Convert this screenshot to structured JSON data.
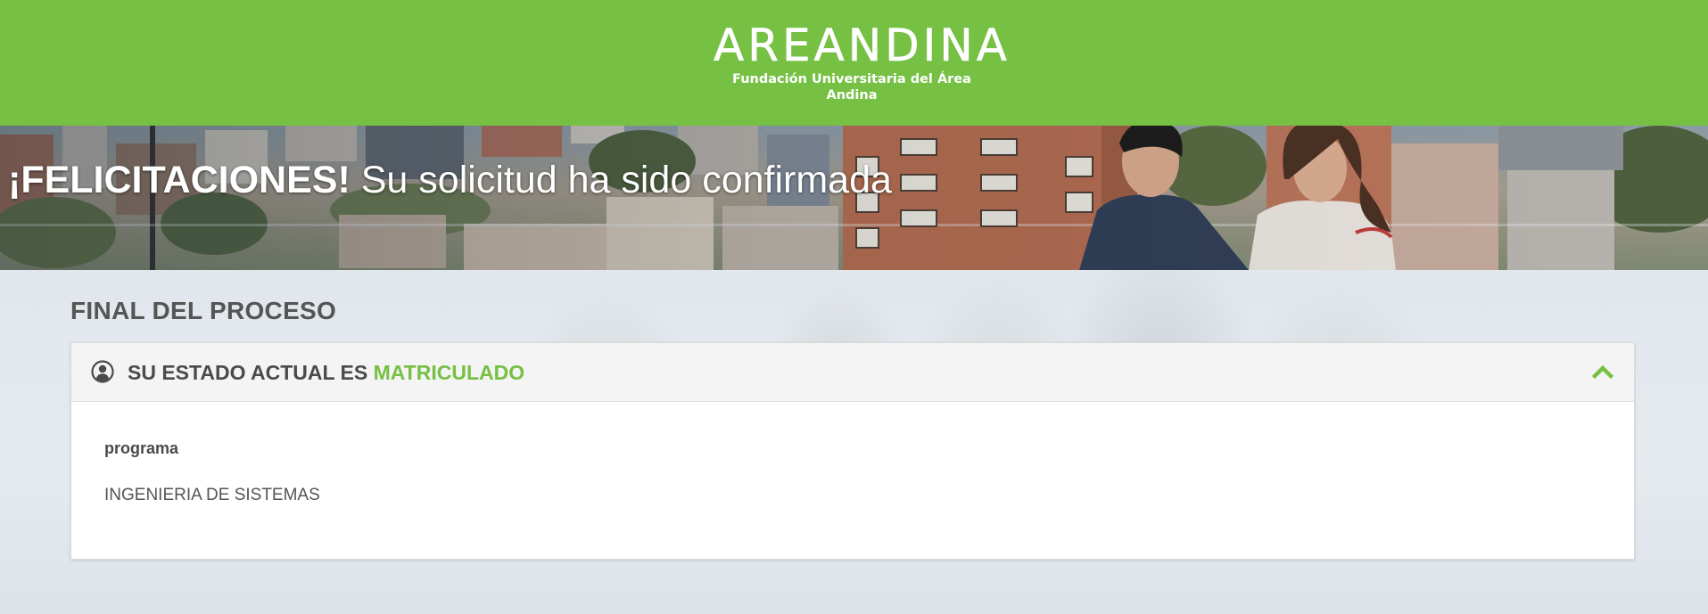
{
  "header": {
    "logo_text": "AREANDINA",
    "logo_subtitle": "Fundación Universitaria del Área Andina",
    "background_color": "#76c043"
  },
  "banner": {
    "title_strong": "¡FELICITACIONES!",
    "title_rest": "Su solicitud ha sido confirmada"
  },
  "main": {
    "section_title": "FINAL DEL PROCESO",
    "panel": {
      "icon": "user-circle-icon",
      "heading_prefix": "SU ESTADO ACTUAL ES",
      "status": "MATRICULADO",
      "status_color": "#76c043",
      "toggle_icon": "chevron-up-icon",
      "field_label": "programa",
      "field_value": "INGENIERIA DE SISTEMAS"
    }
  }
}
